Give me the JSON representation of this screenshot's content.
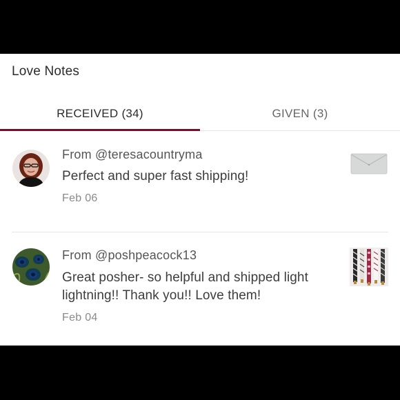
{
  "page": {
    "title": "Love Notes"
  },
  "tabs": [
    {
      "label": "RECEIVED (34)",
      "active": true
    },
    {
      "label": "GIVEN (3)",
      "active": false
    }
  ],
  "notes": [
    {
      "from": "From @teresacountryma",
      "message": "Perfect and super fast shipping!",
      "date": "Feb 06",
      "avatar": "profile-photo-woman-glasses",
      "thumbnail": "silver-clutch-bag"
    },
    {
      "from": "From @poshpeacock13",
      "message": "Great posher- so helpful and shipped light lightning!! Thank you!! Love them!",
      "date": "Feb 04",
      "avatar": "peacock-feather",
      "thumbnail": "bag-straps"
    }
  ],
  "colors": {
    "accent": "#7f0a26",
    "background": "#ffffff",
    "frame": "#000000"
  }
}
